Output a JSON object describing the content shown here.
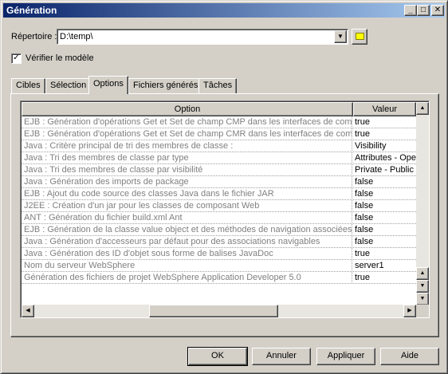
{
  "window": {
    "title": "Génération",
    "controls": {
      "minimize": "_",
      "maximize": "□",
      "close": "✕"
    }
  },
  "directory": {
    "label": "Répertoire :",
    "value": "D:\\temp\\"
  },
  "verify": {
    "label": "Vérifier le modèle",
    "checked": true
  },
  "tabs": [
    {
      "label": "Cibles"
    },
    {
      "label": "Sélection"
    },
    {
      "label": "Options"
    },
    {
      "label": "Fichiers générés"
    },
    {
      "label": "Tâches"
    }
  ],
  "grid": {
    "headers": {
      "option": "Option",
      "value": "Valeur"
    },
    "rows": [
      {
        "option": "EJB : Génération d'opérations Get et Set de champ CMP dans les interfaces de compos",
        "value": "true"
      },
      {
        "option": "EJB : Génération d'opérations Get et Set de champ CMR dans les interfaces de compo",
        "value": "true"
      },
      {
        "option": "Java : Critère principal de tri des membres de classe :",
        "value": "Visibility"
      },
      {
        "option": "Java : Tri des membres de classe par type",
        "value": "Attributes - Opera"
      },
      {
        "option": "Java : Tri des membres de classe par visibilité",
        "value": "Private - Public"
      },
      {
        "option": "Java : Génération des imports de package",
        "value": "false"
      },
      {
        "option": "EJB : Ajout du code source des classes Java dans le fichier JAR",
        "value": "false"
      },
      {
        "option": "J2EE : Création d'un jar pour les classes de composant Web",
        "value": "false"
      },
      {
        "option": "ANT : Génération du fichier build.xml Ant",
        "value": "false"
      },
      {
        "option": "EJB : Génération de la classe value object et des méthodes de navigation associées po",
        "value": "false"
      },
      {
        "option": "Java : Génération d'accesseurs par défaut pour des associations navigables",
        "value": "false"
      },
      {
        "option": "Java : Génération des ID d'objet sous forme de balises JavaDoc",
        "value": "true"
      },
      {
        "option": "Nom du serveur WebSphere",
        "value": "server1"
      },
      {
        "option": "Génération des fichiers de projet WebSphere Application Developer 5.0",
        "value": "true"
      }
    ]
  },
  "buttons": {
    "ok": "OK",
    "cancel": "Annuler",
    "apply": "Appliquer",
    "help": "Aide"
  }
}
